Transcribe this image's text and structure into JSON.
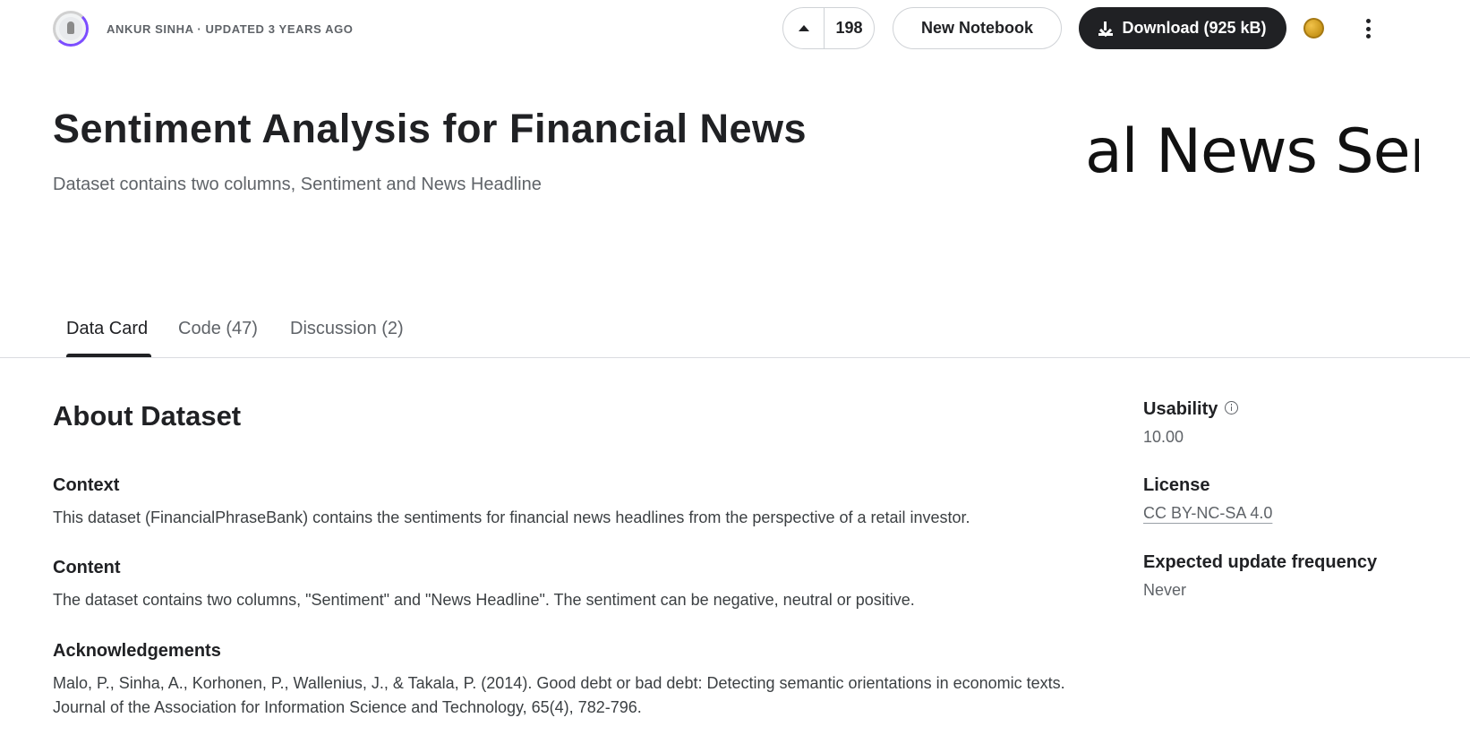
{
  "header": {
    "owner_line": "ANKUR SINHA · UPDATED 3 YEARS AGO",
    "vote_count": "198",
    "new_notebook_label": "New Notebook",
    "download_label": "Download (925 kB)",
    "icons": [
      "avatar",
      "upvote-icon",
      "download-icon",
      "medal-icon",
      "more-vert-icon"
    ]
  },
  "hero": {
    "title": "Sentiment Analysis for Financial News",
    "subtitle": "Dataset contains two columns, Sentiment and News Headline",
    "cover_text": "al News Sen"
  },
  "tabs": [
    {
      "label": "Data Card",
      "active": true
    },
    {
      "label": "Code (47)",
      "active": false
    },
    {
      "label": "Discussion (2)",
      "active": false
    }
  ],
  "about": {
    "heading": "About Dataset",
    "sections": [
      {
        "heading": "Context",
        "lines": [
          "This dataset (FinancialPhraseBank) contains the sentiments for financial news headlines from the perspective of a retail investor."
        ]
      },
      {
        "heading": "Content",
        "lines": [
          "The dataset contains two columns, \"Sentiment\" and \"News Headline\". The sentiment can be negative, neutral or positive."
        ]
      },
      {
        "heading": "Acknowledgements",
        "lines": [
          "Malo, P., Sinha, A., Korhonen, P., Wallenius, J., & Takala, P. (2014). Good debt or bad debt: Detecting semantic orientations in economic texts.",
          "Journal of the Association for Information Science and Technology, 65(4), 782-796."
        ]
      }
    ]
  },
  "sidebar": {
    "usability_label": "Usability",
    "usability_value": "10.00",
    "license_label": "License",
    "license_value": "CC BY-NC-SA 4.0",
    "update_label": "Expected update frequency",
    "update_value": "Never"
  },
  "colors": {
    "primary_dark": "#202124",
    "muted_text": "#5f6368",
    "border": "#dadce0",
    "medal_gold": "#d4a22a",
    "avatar_ring": "#7c4dff"
  }
}
